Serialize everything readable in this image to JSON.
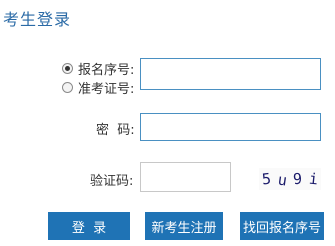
{
  "page_title": "考生登录",
  "id_type": {
    "options": [
      {
        "label": "报名序号:",
        "selected": true
      },
      {
        "label": "准考证号:",
        "selected": false
      }
    ]
  },
  "fields": {
    "id_value": "",
    "password_label": "密  码:",
    "password_value": "",
    "captcha_label": "验证码:",
    "captcha_value": ""
  },
  "captcha_image": {
    "chars": [
      "5",
      "u",
      "9",
      "i"
    ]
  },
  "buttons": {
    "login": "登  录",
    "register": "新考生注册",
    "recover": "找回报名序号"
  },
  "colors": {
    "accent": "#1f73b5",
    "title": "#2a6aa6"
  }
}
